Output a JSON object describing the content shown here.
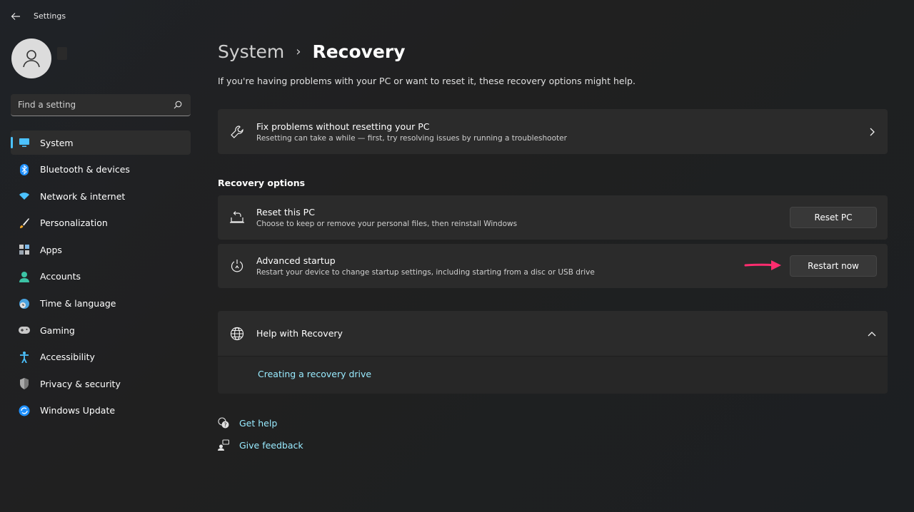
{
  "app": {
    "title": "Settings"
  },
  "search": {
    "placeholder": "Find a setting"
  },
  "sidebar": {
    "items": [
      {
        "label": "System",
        "icon": "monitor-icon",
        "active": true
      },
      {
        "label": "Bluetooth & devices",
        "icon": "bluetooth-icon"
      },
      {
        "label": "Network & internet",
        "icon": "wifi-icon"
      },
      {
        "label": "Personalization",
        "icon": "brush-icon"
      },
      {
        "label": "Apps",
        "icon": "apps-icon"
      },
      {
        "label": "Accounts",
        "icon": "accounts-icon"
      },
      {
        "label": "Time & language",
        "icon": "globe-clock-icon"
      },
      {
        "label": "Gaming",
        "icon": "gamepad-icon"
      },
      {
        "label": "Accessibility",
        "icon": "accessibility-icon"
      },
      {
        "label": "Privacy & security",
        "icon": "shield-icon"
      },
      {
        "label": "Windows Update",
        "icon": "update-icon"
      }
    ]
  },
  "breadcrumb": {
    "parent": "System",
    "separator": "›",
    "current": "Recovery"
  },
  "intro": "If you're having problems with your PC or want to reset it, these recovery options might help.",
  "fix_card": {
    "title": "Fix problems without resetting your PC",
    "desc": "Resetting can take a while — first, try resolving issues by running a troubleshooter"
  },
  "recovery_options": {
    "label": "Recovery options",
    "reset": {
      "title": "Reset this PC",
      "desc": "Choose to keep or remove your personal files, then reinstall Windows",
      "button": "Reset PC"
    },
    "advanced": {
      "title": "Advanced startup",
      "desc": "Restart your device to change startup settings, including starting from a disc or USB drive",
      "button": "Restart now"
    }
  },
  "help": {
    "title": "Help with Recovery",
    "link": "Creating a recovery drive"
  },
  "footer": {
    "get_help": "Get help",
    "give_feedback": "Give feedback"
  },
  "colors": {
    "accent": "#4cc2ff",
    "link": "#99ebff",
    "annotation": "#ff2d6f",
    "card": "#2b2b2b"
  }
}
